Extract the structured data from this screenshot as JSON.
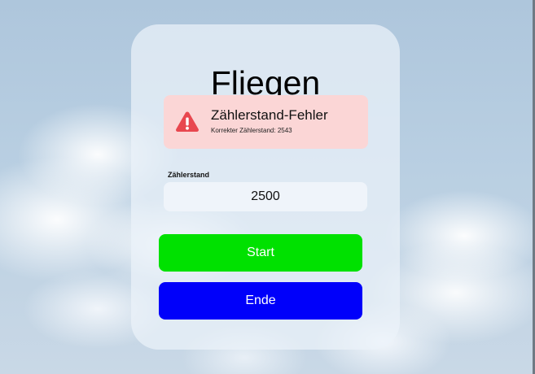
{
  "page": {
    "title": "Fliegen"
  },
  "alert": {
    "title": "Zählerstand-Fehler",
    "message": "Korrekter Zählerstand: 2543",
    "icon": "warning-triangle-icon",
    "background_color": "#fbd6d6",
    "icon_color": "#e8474f"
  },
  "counter_field": {
    "label": "Zählerstand",
    "value": "2500"
  },
  "buttons": {
    "start_label": "Start",
    "start_color": "#00e100",
    "end_label": "Ende",
    "end_color": "#0000fa"
  }
}
